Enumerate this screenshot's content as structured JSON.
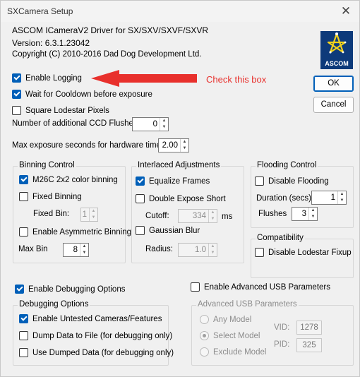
{
  "window": {
    "title": "SXCamera Setup",
    "close_glyph": "✕"
  },
  "header": {
    "driver": "ASCOM ICameraV2 Driver for SX/SXV/SXVF/SXVR",
    "version": "Version: 6.3.1.23042",
    "copyright": "Copyright (C) 2010-2016 Dad Dog Development Ltd.",
    "logo_text": "ASCOM"
  },
  "annotation": {
    "text": "Check this box",
    "color": "#e8302c"
  },
  "buttons": {
    "ok": "OK",
    "cancel": "Cancel"
  },
  "options": {
    "enable_logging": {
      "label": "Enable Logging",
      "checked": true
    },
    "wait_cooldown": {
      "label": "Wait for Cooldown before exposure",
      "checked": true
    },
    "square_lodestar": {
      "label": "Square Lodestar Pixels",
      "checked": false
    },
    "ccd_flushes": {
      "label": "Number of additional CCD Flushes",
      "value": "0"
    },
    "max_exposure": {
      "label": "Max exposure seconds for hardware timer",
      "value": "2.00"
    }
  },
  "binning": {
    "title": "Binning Control",
    "m26c": {
      "label": "M26C 2x2 color binning",
      "checked": true
    },
    "fixed": {
      "label": "Fixed Binning",
      "checked": false
    },
    "fixed_bin": {
      "label": "Fixed Bin:",
      "value": "1"
    },
    "asym": {
      "label": "Enable Asymmetric Binning",
      "checked": false
    },
    "max_bin": {
      "label": "Max Bin",
      "value": "8"
    }
  },
  "interlaced": {
    "title": "Interlaced Adjustments",
    "equalize": {
      "label": "Equalize Frames",
      "checked": true
    },
    "double": {
      "label": "Double Expose Short",
      "checked": false
    },
    "cutoff": {
      "label": "Cutoff:",
      "value": "334",
      "unit": "ms"
    },
    "gaussian": {
      "label": "Gaussian Blur",
      "checked": false
    },
    "radius": {
      "label": "Radius:",
      "value": "1.0"
    }
  },
  "flooding": {
    "title": "Flooding Control",
    "disable": {
      "label": "Disable Flooding",
      "checked": false
    },
    "duration": {
      "label": "Duration (secs)",
      "value": "1"
    },
    "flushes": {
      "label": "Flushes",
      "value": "3"
    }
  },
  "compat": {
    "title": "Compatibility",
    "lodestar": {
      "label": "Disable Lodestar Fixup",
      "checked": false
    }
  },
  "debugging": {
    "enable": {
      "label": "Enable Debugging Options",
      "checked": true
    },
    "title": "Debugging Options",
    "untested": {
      "label": "Enable Untested Cameras/Features",
      "checked": true
    },
    "dump": {
      "label": "Dump Data to File (for debugging only)",
      "checked": false
    },
    "use_dumped": {
      "label": "Use Dumped Data (for debugging only)",
      "checked": false
    }
  },
  "usb": {
    "enable": {
      "label": "Enable Advanced USB Parameters",
      "checked": false
    },
    "title": "Advanced USB Parameters",
    "any": "Any Model",
    "select": "Select Model",
    "exclude": "Exclude Model",
    "selected": "Select Model",
    "vid_label": "VID:",
    "vid": "1278",
    "pid_label": "PID:",
    "pid": "325"
  }
}
